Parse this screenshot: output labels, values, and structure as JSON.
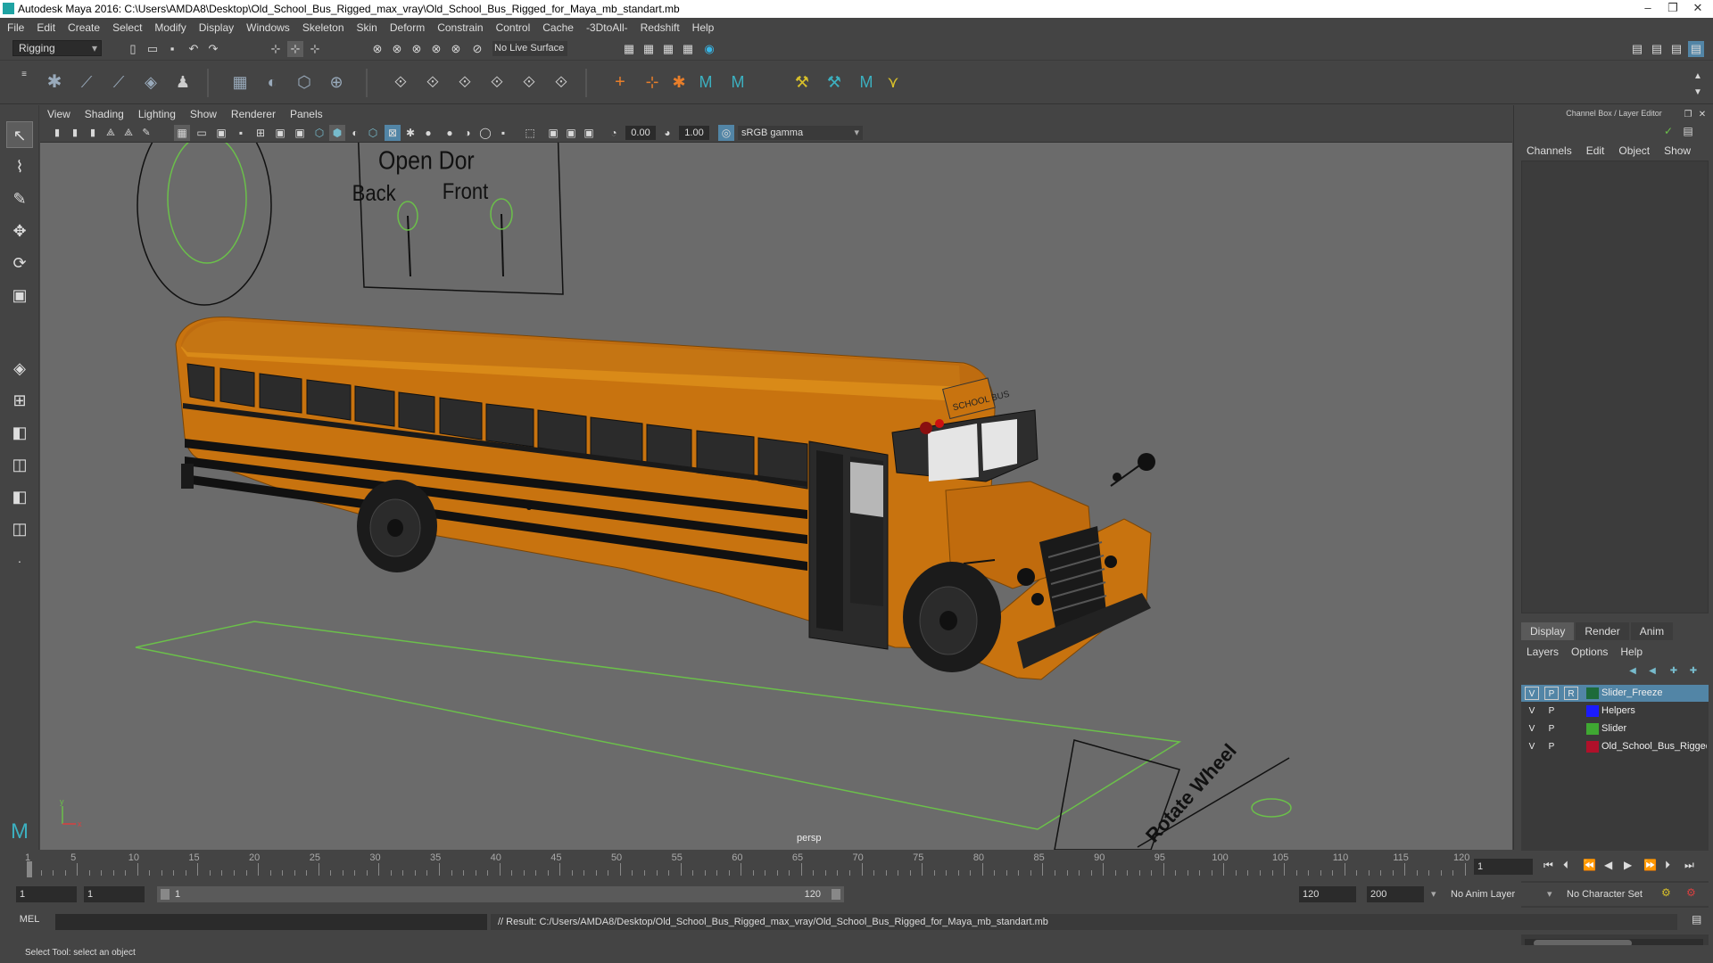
{
  "window": {
    "title": "Autodesk Maya 2016: C:\\Users\\AMDA8\\Desktop\\Old_School_Bus_Rigged_max_vray\\Old_School_Bus_Rigged_for_Maya_mb_standart.mb"
  },
  "menu": [
    "File",
    "Edit",
    "Create",
    "Select",
    "Modify",
    "Display",
    "Windows",
    "Skeleton",
    "Skin",
    "Deform",
    "Constrain",
    "Control",
    "Cache",
    "-3DtoAll-",
    "Redshift",
    "Help"
  ],
  "status": {
    "mode": "Rigging",
    "live_surface": "No Live Surface"
  },
  "panel": {
    "menu": [
      "View",
      "Shading",
      "Lighting",
      "Show",
      "Renderer",
      "Panels"
    ],
    "exposure": "0.00",
    "gamma": "1.00",
    "colorspace": "sRGB gamma",
    "camera": "persp"
  },
  "scene": {
    "sign_title": "Open Dor",
    "sign_back": "Back",
    "sign_front": "Front",
    "rotate_label": "Rotate Wheel",
    "bus_sign": "SCHOOL BUS",
    "axis_y": "y",
    "axis_x": "x"
  },
  "channelbox": {
    "title": "Channel Box / Layer Editor",
    "menu": [
      "Channels",
      "Edit",
      "Object",
      "Show"
    ]
  },
  "layers": {
    "tabs": [
      "Display",
      "Render",
      "Anim"
    ],
    "menu": [
      "Layers",
      "Options",
      "Help"
    ],
    "rows": [
      {
        "v": "V",
        "p": "P",
        "r": "R",
        "name": "Slider_Freeze",
        "color": "#1d6b3a"
      },
      {
        "v": "V",
        "p": "P",
        "r": "",
        "name": "Helpers",
        "color": "#1b1bff"
      },
      {
        "v": "V",
        "p": "P",
        "r": "",
        "name": "Slider",
        "color": "#3fa832"
      },
      {
        "v": "V",
        "p": "P",
        "r": "",
        "name": "Old_School_Bus_Rigged",
        "color": "#b0102a"
      }
    ]
  },
  "timeline": {
    "ticks": [
      "5",
      "10",
      "15",
      "20",
      "25",
      "30",
      "35",
      "40",
      "45",
      "50",
      "55",
      "60",
      "65",
      "70",
      "75",
      "80",
      "85",
      "90",
      "95",
      "100",
      "105",
      "110",
      "115",
      "120"
    ],
    "start_label": "1",
    "current_frame": "1"
  },
  "range": {
    "start": "1",
    "playback_start": "1",
    "slider_start": "1",
    "slider_end": "120",
    "playback_end": "120",
    "end": "200",
    "anim_layer": "No Anim Layer",
    "char_set": "No Character Set"
  },
  "command": {
    "mel": "MEL",
    "result": "// Result: C:/Users/AMDA8/Desktop/Old_School_Bus_Rigged_max_vray/Old_School_Bus_Rigged_for_Maya_mb_standart.mb"
  },
  "help": "Select Tool: select an object"
}
